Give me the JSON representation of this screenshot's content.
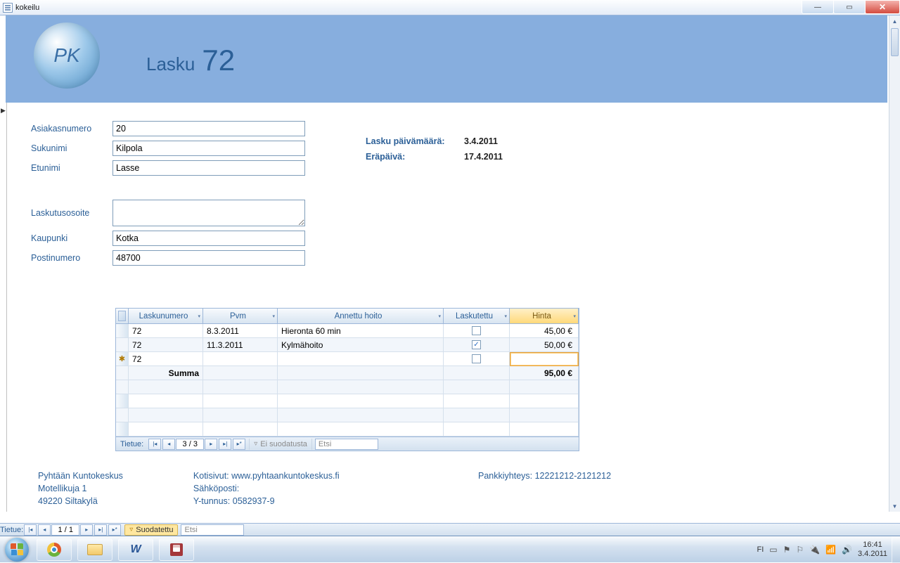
{
  "window": {
    "title": "kokeilu"
  },
  "header": {
    "title_label": "Lasku",
    "invoice_number": "72",
    "logo_text": "PK"
  },
  "fields": {
    "customer_num_label": "Asiakasnumero",
    "customer_num": "20",
    "lastname_label": "Sukunimi",
    "lastname": "Kilpola",
    "firstname_label": "Etunimi",
    "firstname": "Lasse",
    "billing_addr_label": "Laskutusosoite",
    "billing_addr": "",
    "city_label": "Kaupunki",
    "city": "Kotka",
    "zip_label": "Postinumero",
    "zip": "48700"
  },
  "meta": {
    "date_label": "Lasku päivämäärä:",
    "date": "3.4.2011",
    "due_label": "Eräpäivä:",
    "due": "17.4.2011"
  },
  "grid": {
    "headers": {
      "lasku": "Laskunumero",
      "pvm": "Pvm",
      "hoito": "Annettu hoito",
      "lkt": "Laskutettu",
      "hinta": "Hinta"
    },
    "rows": [
      {
        "lasku": "72",
        "pvm": "8.3.2011",
        "hoito": "Hieronta 60 min",
        "lkt": false,
        "hinta": "45,00 €"
      },
      {
        "lasku": "72",
        "pvm": "11.3.2011",
        "hoito": "Kylmähoito",
        "lkt": true,
        "hinta": "50,00 €"
      },
      {
        "lasku": "72",
        "pvm": "",
        "hoito": "",
        "lkt": false,
        "hinta": "",
        "new": true
      }
    ],
    "sum_label": "Summa",
    "sum_value": "95,00 €"
  },
  "subnav": {
    "label": "Tietue:",
    "pos": "3 / 3",
    "filter": "Ei suodatusta",
    "search": "Etsi"
  },
  "mainnav": {
    "label": "Tietue:",
    "pos": "1 / 1",
    "filter": "Suodatettu",
    "search": "Etsi"
  },
  "company": {
    "name": "Pyhtään Kuntokeskus",
    "street": "Motellikuja 1",
    "postal": "49220 Siltakylä",
    "web_label": "Kotisivut: ",
    "web": "www.pyhtaankuntokeskus.fi",
    "email_label": "Sähköposti:",
    "bizid_label": "Y-tunnus: ",
    "bizid": "0582937-9",
    "bank_label": "Pankkiyhteys: ",
    "bank": "12221212-2121212"
  },
  "tray": {
    "lang": "FI",
    "time": "16:41",
    "date": "3.4.2011"
  }
}
